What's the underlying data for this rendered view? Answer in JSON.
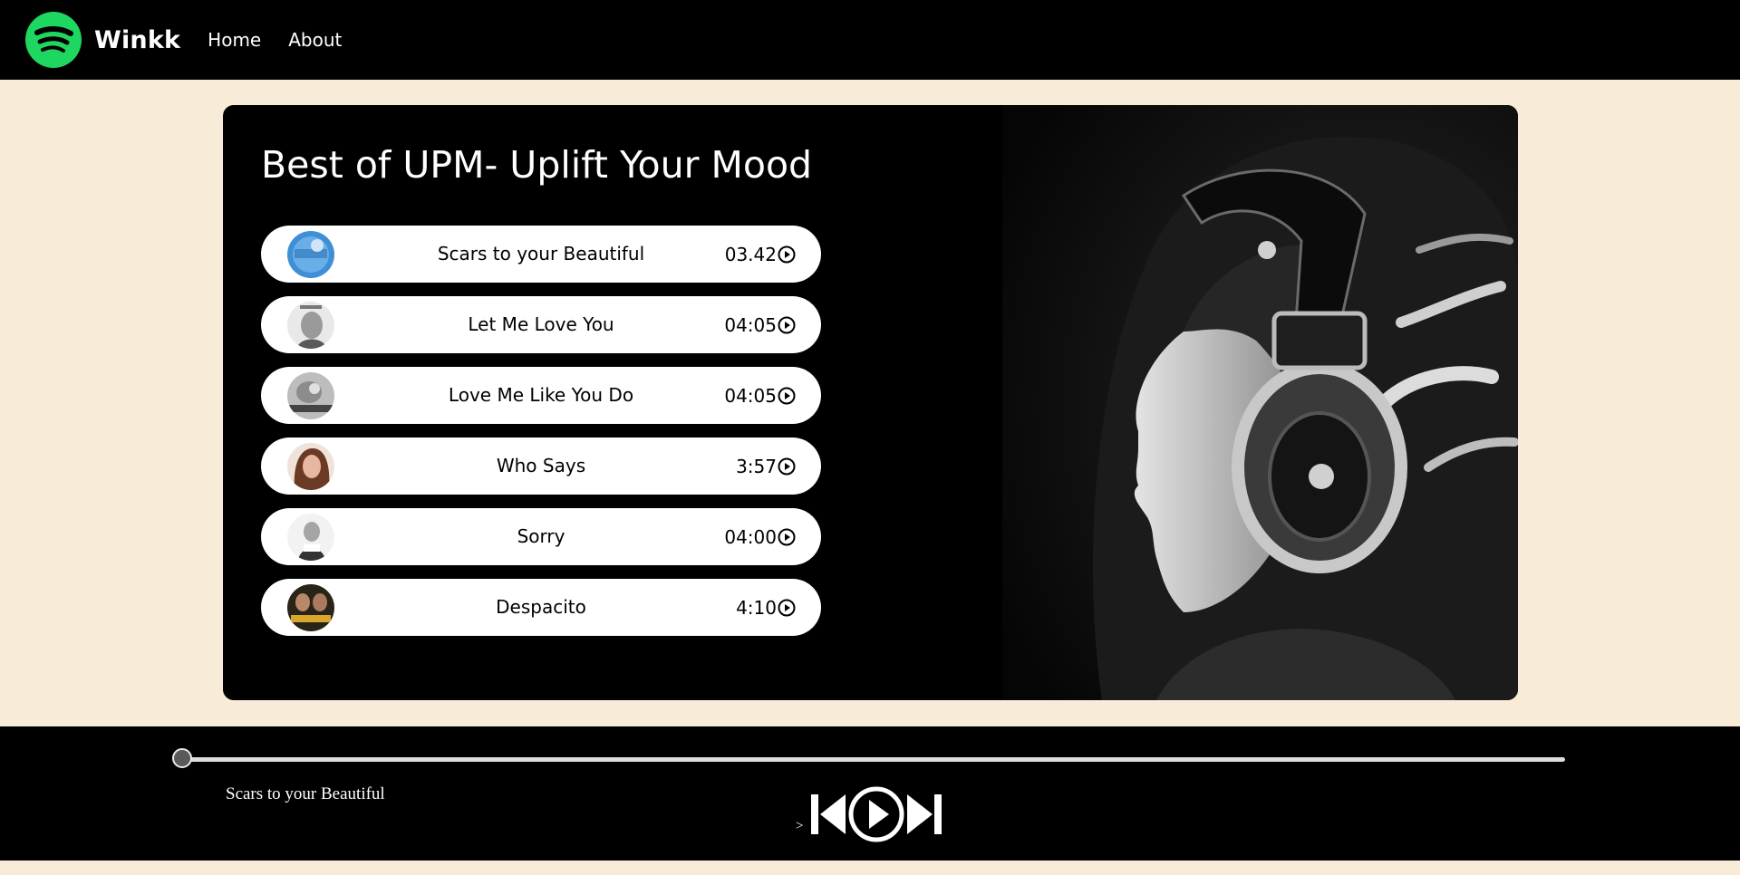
{
  "nav": {
    "logo_icon": "spotify-logo-icon",
    "brand": "Winkk",
    "links": [
      "Home",
      "About"
    ]
  },
  "main": {
    "title": "Best of UPM- Uplift Your Mood",
    "songs": [
      {
        "name": "Scars to your Beautiful",
        "duration": "03.42"
      },
      {
        "name": "Let Me Love You",
        "duration": "04:05"
      },
      {
        "name": "Love Me Like You Do",
        "duration": "04:05"
      },
      {
        "name": "Who Says",
        "duration": "3:57"
      },
      {
        "name": "Sorry",
        "duration": "04:00"
      },
      {
        "name": "Despacito",
        "duration": "4:10"
      }
    ],
    "song_play_icon": "play-circle-icon",
    "photo": "woman-with-headphones-photo"
  },
  "player": {
    "now_playing": "Scars to your Beautiful",
    "progress": 0,
    "marker": ">",
    "controls": [
      "previous-icon",
      "play-icon",
      "next-icon"
    ]
  },
  "colors": {
    "brand_green": "#1ed760",
    "nav_bg": "#000000",
    "page_bg": "#f8ebd7",
    "song_row_bg": "#ffffff"
  }
}
